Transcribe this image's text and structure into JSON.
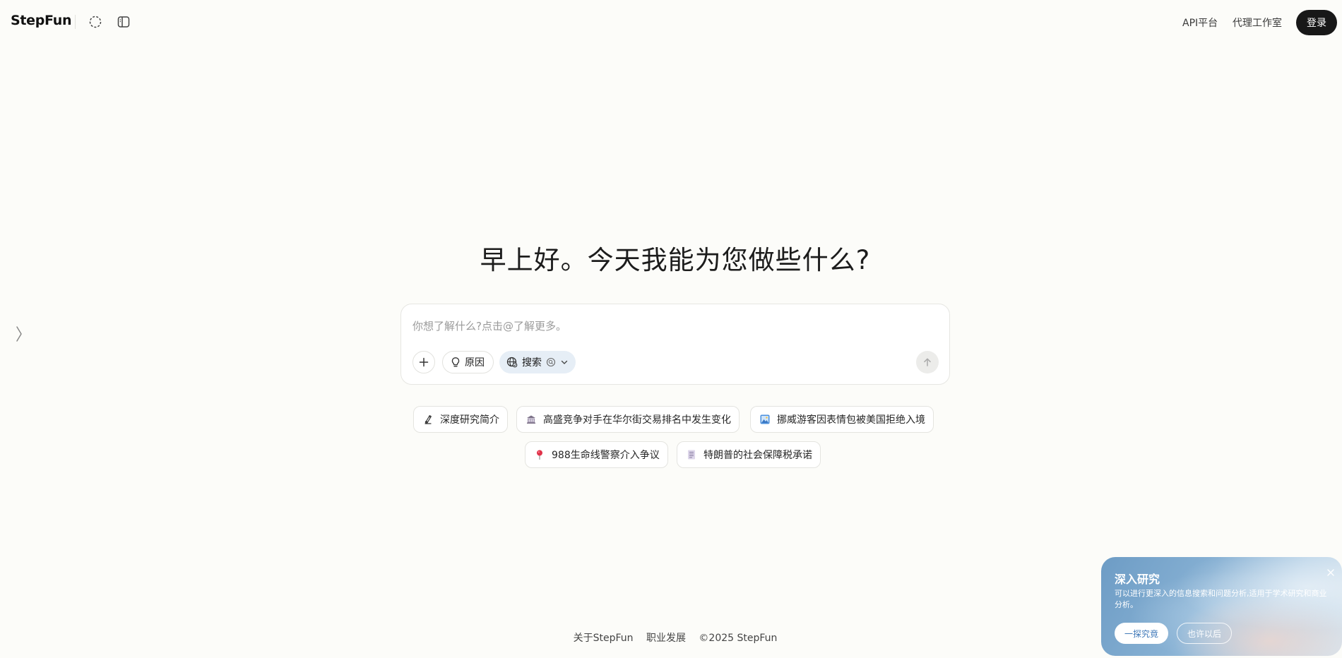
{
  "header": {
    "logo": "StepFun",
    "links": {
      "api": "API平台",
      "agent": "代理工作室"
    },
    "login_label": "登录"
  },
  "greeting": "早上好。今天我能为您做些什么?",
  "composer": {
    "placeholder": "你想了解什么?点击@了解更多。",
    "reason_label": "原因",
    "search_label": "搜索"
  },
  "suggestions": [
    {
      "label": "深度研究简介",
      "icon": "research-icon"
    },
    {
      "label": "高盛竞争对手在华尔街交易排名中发生变化",
      "icon": "bank-building-icon"
    },
    {
      "label": "挪威游客因表情包被美国拒绝入境",
      "icon": "picture-icon"
    },
    {
      "label": "988生命线警察介入争议",
      "icon": "pin-icon"
    },
    {
      "label": "特朗普的社会保障税承诺",
      "icon": "document-icon"
    }
  ],
  "footer": {
    "about": "关于StepFun",
    "careers": "职业发展",
    "copyright": "©2025 StepFun"
  },
  "promo": {
    "title": "深入研究",
    "description": "可以进行更深入的信息搜索和问题分析,适用于学术研究和商业分析。",
    "primary_label": "一探究竟",
    "secondary_label": "也许以后"
  },
  "colors": {
    "background": "#fcfcf9",
    "login_button": "#181818",
    "search_chip": "#e6eef6",
    "promo_accent": "#3f78b8"
  }
}
